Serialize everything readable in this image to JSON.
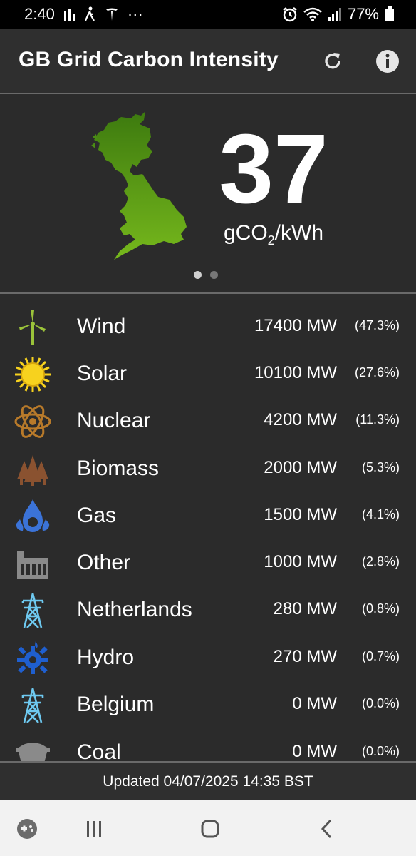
{
  "status_bar": {
    "time": "2:40",
    "battery": "77%"
  },
  "app": {
    "title": "GB Grid Carbon Intensity"
  },
  "intensity": {
    "value": "37",
    "unit_main": "gCO",
    "unit_sub": "2",
    "unit_tail": "/kWh"
  },
  "pager": {
    "pages": 2,
    "active": 1
  },
  "sources": [
    {
      "name": "Wind",
      "mw": "17400 MW",
      "pct": "(47.3%)",
      "icon": "wind-turbine-icon"
    },
    {
      "name": "Solar",
      "mw": "10100 MW",
      "pct": "(27.6%)",
      "icon": "sun-icon"
    },
    {
      "name": "Nuclear",
      "mw": "4200 MW",
      "pct": "(11.3%)",
      "icon": "atom-icon"
    },
    {
      "name": "Biomass",
      "mw": "2000 MW",
      "pct": "(5.3%)",
      "icon": "trees-icon"
    },
    {
      "name": "Gas",
      "mw": "1500 MW",
      "pct": "(4.1%)",
      "icon": "flame-icon"
    },
    {
      "name": "Other",
      "mw": "1000 MW",
      "pct": "(2.8%)",
      "icon": "factory-icon"
    },
    {
      "name": "Netherlands",
      "mw": "280 MW",
      "pct": "(0.8%)",
      "icon": "pylon-icon"
    },
    {
      "name": "Hydro",
      "mw": "270 MW",
      "pct": "(0.7%)",
      "icon": "water-wheel-icon"
    },
    {
      "name": "Belgium",
      "mw": "0 MW",
      "pct": "(0.0%)",
      "icon": "pylon-icon"
    },
    {
      "name": "Coal",
      "mw": "0 MW",
      "pct": "(0.0%)",
      "icon": "coal-cart-icon"
    }
  ],
  "footer": {
    "updated": "Updated 04/07/2025 14:35 BST"
  },
  "colors": {
    "wind": "#9bc33a",
    "solar": "#f7d21e",
    "nuclear": "#b87a2a",
    "biomass": "#8a5230",
    "gas": "#3b73d8",
    "other": "#8a8a8a",
    "interconnector": "#6ec9f0",
    "hydro": "#1f5fcf",
    "map": "#5a9e12"
  }
}
